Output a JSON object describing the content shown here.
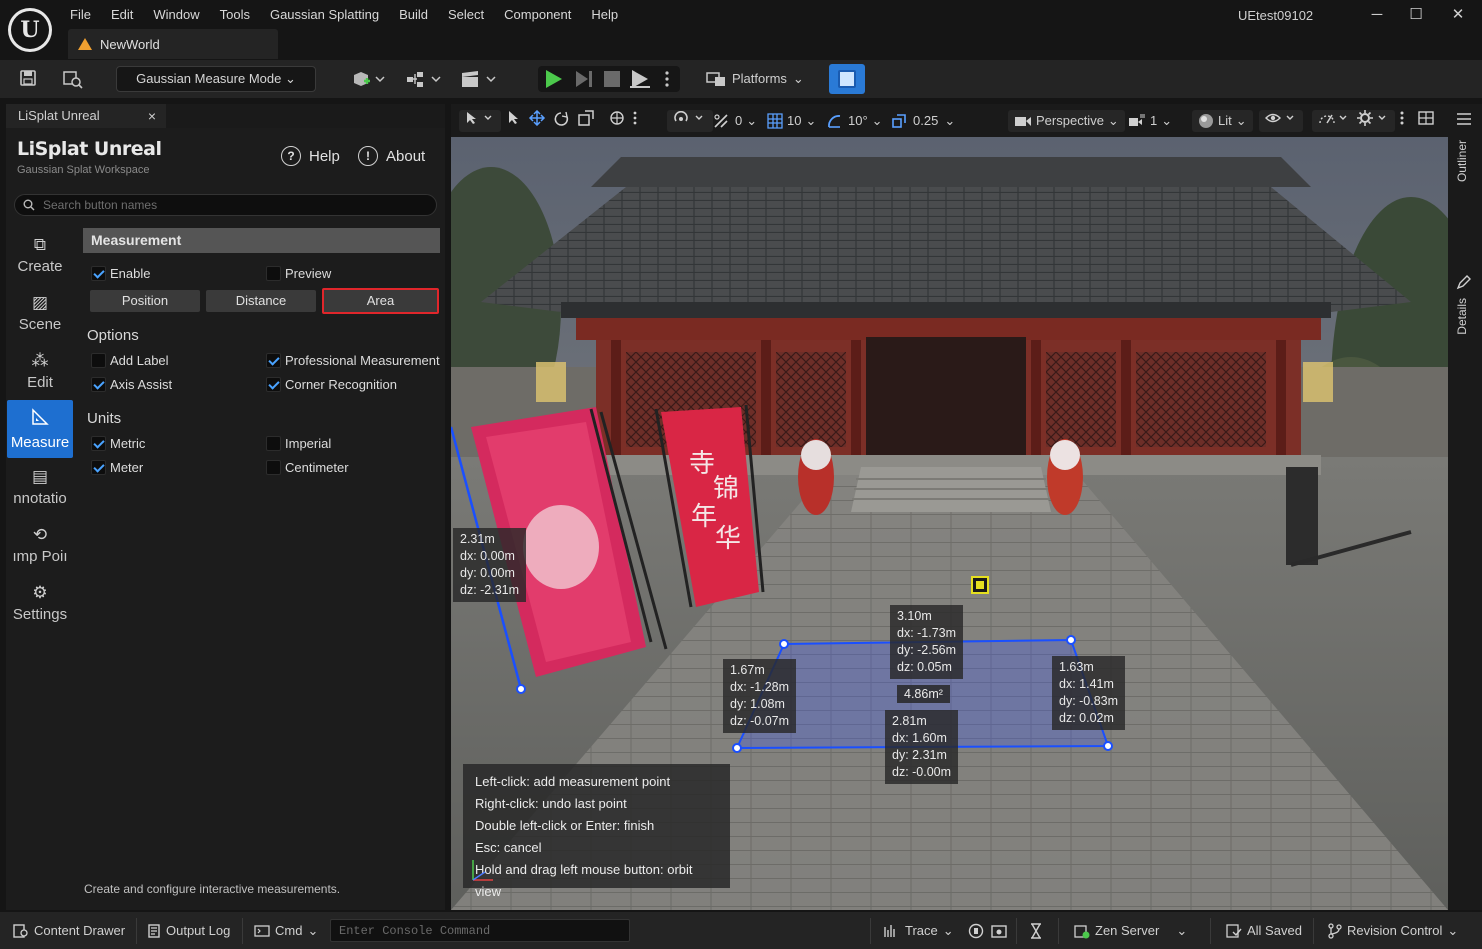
{
  "window": {
    "project_name": "UEtest09102",
    "menu": [
      "File",
      "Edit",
      "Window",
      "Tools",
      "Gaussian Splatting",
      "Build",
      "Select",
      "Component",
      "Help"
    ],
    "doc_tab": "NewWorld",
    "controls": {
      "minimize": "─",
      "maximize": "☐",
      "close": "✕"
    }
  },
  "toolbar": {
    "mode": "Gaussian Measure Mode",
    "platforms": "Platforms"
  },
  "panel": {
    "tab_title": "LiSplat Unreal",
    "tab_close": "×",
    "app_title": "LiSplat Unreal",
    "app_subtitle": "Gaussian Splat Workspace",
    "help": "Help",
    "about": "About",
    "search_placeholder": "Search button names",
    "nav": [
      {
        "label": "Create",
        "icon": "⧉"
      },
      {
        "label": "Scene",
        "icon": "▨"
      },
      {
        "label": "Edit",
        "icon": "⁂"
      },
      {
        "label": "Measure",
        "icon": "📐"
      },
      {
        "label": "nnotatio",
        "icon": "▤"
      },
      {
        "label": "ımp Poiı",
        "icon": "⟲"
      },
      {
        "label": "Settings",
        "icon": "⚙"
      }
    ],
    "section_title": "Measurement",
    "enable": "Enable",
    "preview": "Preview",
    "modes": [
      "Position",
      "Distance",
      "Area"
    ],
    "options_title": "Options",
    "options": [
      "Add Label",
      "Professional Measurement",
      "Axis Assist",
      "Corner Recognition"
    ],
    "units_title": "Units",
    "units": [
      "Metric",
      "Imperial",
      "Meter",
      "Centimeter"
    ],
    "footer": "Create and configure interactive measurements."
  },
  "viewport_toolbar": {
    "translate_snap": "0",
    "grid_snap": "10",
    "rotate_snap": "10°",
    "scale_snap": "0.25",
    "view_mode": "Perspective",
    "camera_speed": "1",
    "lighting": "Lit"
  },
  "measurements": {
    "vertical": {
      "length": "2.31m",
      "dx": "dx: 0.00m",
      "dy": "dy: 0.00m",
      "dz": "dz: -2.31m"
    },
    "top": {
      "length": "3.10m",
      "dx": "dx: -1.73m",
      "dy": "dy: -2.56m",
      "dz": "dz: 0.05m"
    },
    "left": {
      "length": "1.67m",
      "dx": "dx: -1.28m",
      "dy": "dy: 1.08m",
      "dz": "dz: -0.07m"
    },
    "right": {
      "length": "1.63m",
      "dx": "dx: 1.41m",
      "dy": "dy: -0.83m",
      "dz": "dz: 0.02m"
    },
    "bottom": {
      "length": "2.81m",
      "dx": "dx: 1.60m",
      "dy": "dy: 2.31m",
      "dz": "dz: -0.00m"
    },
    "area": "4.86m²"
  },
  "help_lines": [
    "Left-click: add measurement point",
    "Right-click: undo last point",
    "Double left-click or Enter: finish",
    "Esc: cancel",
    "Hold and drag left mouse button: orbit view"
  ],
  "right_tabs": [
    "Outliner",
    "Details"
  ],
  "statusbar": {
    "content_drawer": "Content Drawer",
    "output_log": "Output Log",
    "cmd": "Cmd",
    "console_placeholder": "Enter Console Command",
    "trace": "Trace",
    "zen_server": "Zen Server",
    "all_saved": "All Saved",
    "revision_control": "Revision Control"
  },
  "colors": {
    "accent": "#1e6fd0",
    "selected_outline": "#e0262b",
    "measure_line": "#1a4fff",
    "check": "#4aa3ff"
  }
}
